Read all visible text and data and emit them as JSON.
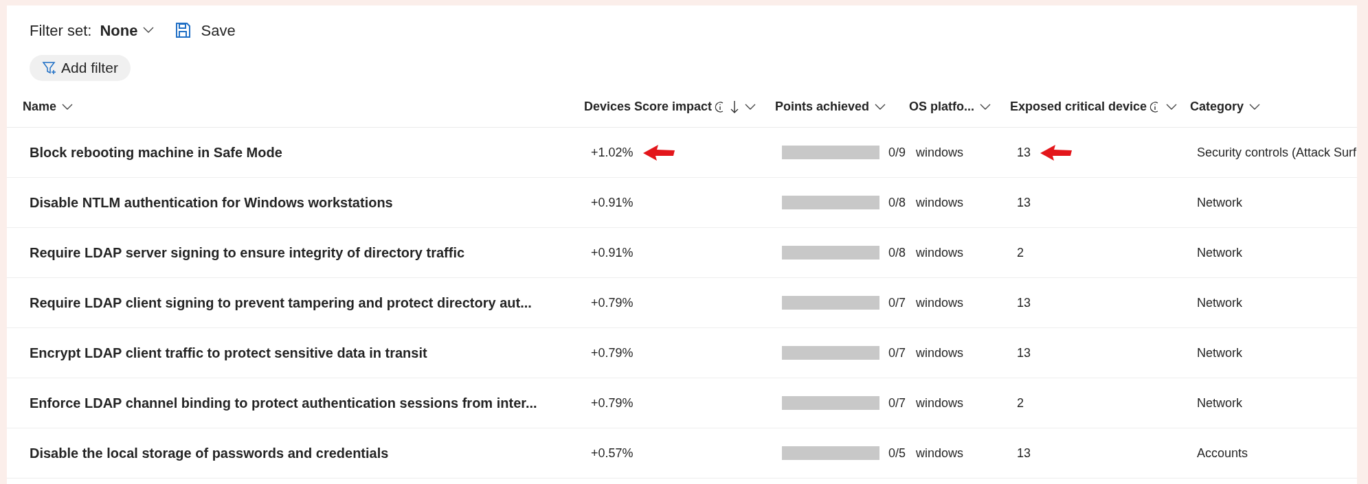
{
  "toolbar": {
    "filter_set_label": "Filter set:",
    "filter_set_value": "None",
    "save": "Save",
    "add_filter": "Add filter"
  },
  "table": {
    "columns": [
      {
        "label": "Name",
        "info": false,
        "sorted": false
      },
      {
        "label": "Devices Score impact",
        "info": true,
        "sorted": true
      },
      {
        "label": "Points achieved",
        "info": false,
        "sorted": false
      },
      {
        "label": "OS platfo...",
        "info": false,
        "sorted": false
      },
      {
        "label": "Exposed critical device",
        "info": true,
        "sorted": false
      },
      {
        "label": "Category",
        "info": false,
        "sorted": false
      }
    ],
    "rows": [
      {
        "name": "Block rebooting machine in Safe Mode",
        "impact": "+1.02%",
        "points": "0/9",
        "os": "windows",
        "exposed": "13",
        "category": "Security controls (Attack Surf",
        "marked": true
      },
      {
        "name": "Disable NTLM authentication for Windows workstations",
        "impact": "+0.91%",
        "points": "0/8",
        "os": "windows",
        "exposed": "13",
        "category": "Network",
        "marked": false
      },
      {
        "name": "Require LDAP server signing to ensure integrity of directory traffic",
        "impact": "+0.91%",
        "points": "0/8",
        "os": "windows",
        "exposed": "2",
        "category": "Network",
        "marked": false
      },
      {
        "name": "Require LDAP client signing to prevent tampering and protect directory aut...",
        "impact": "+0.79%",
        "points": "0/7",
        "os": "windows",
        "exposed": "13",
        "category": "Network",
        "marked": false
      },
      {
        "name": "Encrypt LDAP client traffic to protect sensitive data in transit",
        "impact": "+0.79%",
        "points": "0/7",
        "os": "windows",
        "exposed": "13",
        "category": "Network",
        "marked": false
      },
      {
        "name": "Enforce LDAP channel binding to protect authentication sessions from inter...",
        "impact": "+0.79%",
        "points": "0/7",
        "os": "windows",
        "exposed": "2",
        "category": "Network",
        "marked": false
      },
      {
        "name": "Disable the local storage of passwords and credentials",
        "impact": "+0.57%",
        "points": "0/5",
        "os": "windows",
        "exposed": "13",
        "category": "Accounts",
        "marked": false
      }
    ]
  }
}
